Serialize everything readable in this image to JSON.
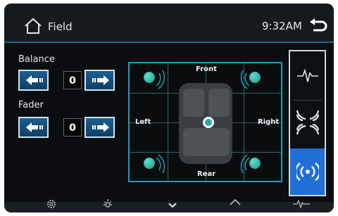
{
  "header": {
    "title": "Field",
    "time": "9:32AM",
    "home_icon": "home-icon",
    "back_icon": "back-icon"
  },
  "balance": {
    "label": "Balance",
    "value": "0"
  },
  "fader": {
    "label": "Fader",
    "value": "0"
  },
  "field": {
    "front_label": "Front",
    "rear_label": "Rear",
    "left_label": "Left",
    "right_label": "Right"
  },
  "effects": {
    "items": [
      "waveform-icon",
      "surround-icon",
      "broadcast-icon"
    ],
    "active": "broadcast-icon"
  },
  "bottom_bar": {
    "icons": [
      "settings-icon",
      "brightness-icon",
      "chevron-down-icon",
      "home-icon",
      "waveform-icon"
    ]
  },
  "colors": {
    "accent": "#1aa0b8",
    "button": "#1c5f90",
    "active": "#1f6fd6"
  }
}
